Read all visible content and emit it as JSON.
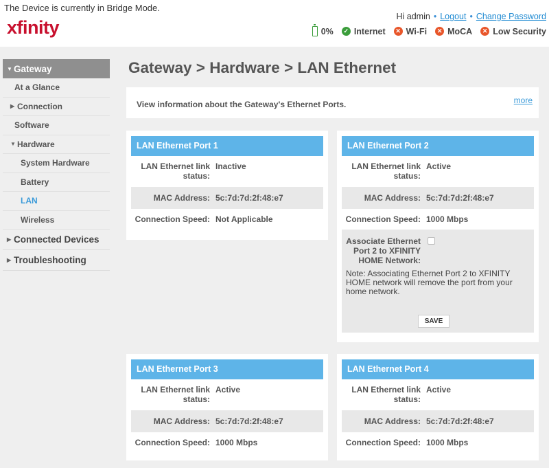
{
  "header": {
    "bridge_mode_note": "The Device is currently in Bridge Mode.",
    "logo_text": "xfinity",
    "greeting": "Hi admin",
    "logout": "Logout",
    "change_password": "Change Password",
    "status": {
      "battery": "0%",
      "internet": "Internet",
      "wifi": "Wi-Fi",
      "moca": "MoCA",
      "security": "Low Security"
    }
  },
  "sidebar": {
    "gateway": "Gateway",
    "at_a_glance": "At a Glance",
    "connection": "Connection",
    "software": "Software",
    "hardware": "Hardware",
    "system_hardware": "System Hardware",
    "battery": "Battery",
    "lan": "LAN",
    "wireless": "Wireless",
    "connected_devices": "Connected Devices",
    "troubleshooting": "Troubleshooting"
  },
  "main": {
    "title": "Gateway > Hardware > LAN Ethernet",
    "info_text": "View information about the Gateway's Ethernet Ports.",
    "more": "more",
    "labels": {
      "link_status": "LAN Ethernet link status:",
      "mac": "MAC Address:",
      "speed": "Connection Speed:"
    },
    "ports": [
      {
        "title": "LAN Ethernet Port 1",
        "status": "Inactive",
        "mac": "5c:7d:7d:2f:48:e7",
        "speed": "Not Applicable"
      },
      {
        "title": "LAN Ethernet Port 2",
        "status": "Active",
        "mac": "5c:7d:7d:2f:48:e7",
        "speed": "1000 Mbps"
      },
      {
        "title": "LAN Ethernet Port 3",
        "status": "Active",
        "mac": "5c:7d:7d:2f:48:e7",
        "speed": "1000 Mbps"
      },
      {
        "title": "LAN Ethernet Port 4",
        "status": "Active",
        "mac": "5c:7d:7d:2f:48:e7",
        "speed": "1000 Mbps"
      }
    ],
    "associate_label": "Associate Ethernet Port 2 to XFINITY HOME Network:",
    "associate_note": "Note: Associating Ethernet Port 2 to XFINITY HOME network will remove the port from your home network.",
    "save": "SAVE"
  },
  "colors": {
    "brand_red": "#c8102e",
    "port_header_blue": "#5eb4e8",
    "link_blue": "#1f8ad2",
    "ok_green": "#3b9d3b",
    "error_orange": "#e8562a"
  },
  "icons": [
    "battery-icon",
    "check-circle-icon",
    "x-circle-icon",
    "caret-down-icon",
    "caret-right-icon"
  ]
}
